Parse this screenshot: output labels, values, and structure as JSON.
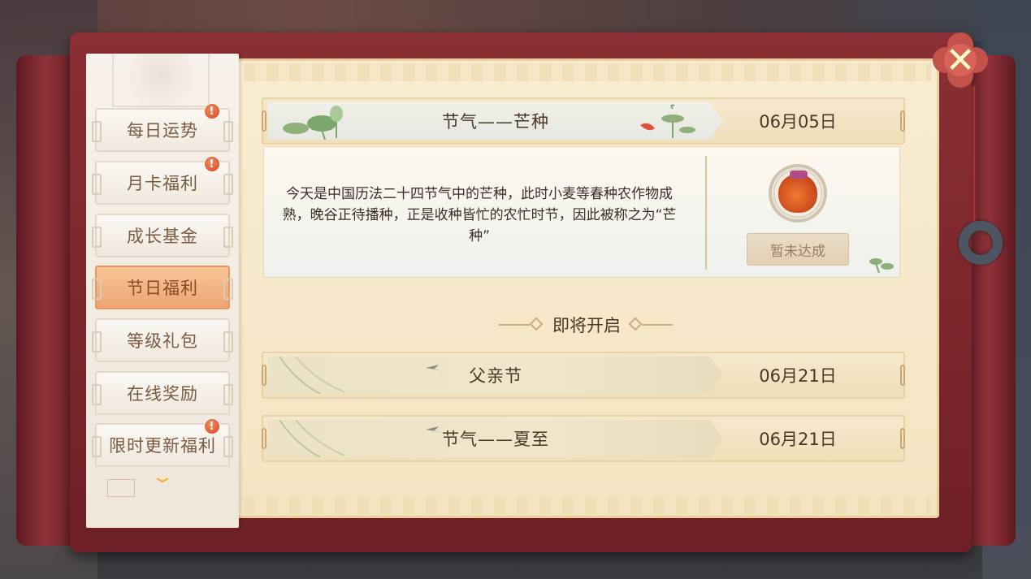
{
  "sidebar": {
    "items": [
      {
        "label": "每日运势",
        "badge": "!"
      },
      {
        "label": "月卡福利",
        "badge": "!"
      },
      {
        "label": "成长基金",
        "badge": ""
      },
      {
        "label": "节日福利",
        "badge": "",
        "active": true
      },
      {
        "label": "等级礼包",
        "badge": ""
      },
      {
        "label": "在线奖励",
        "badge": ""
      },
      {
        "label": "限时更新福利",
        "badge": "!"
      }
    ],
    "more_icon": "chevron-down-icon"
  },
  "current_festival": {
    "name": "节气——芒种",
    "date": "06月05日",
    "description": "今天是中国历法二十四节气中的芒种，此时小麦等春种农作物成熟，晚谷正待播种，正是收种皆忙的农忙时节，因此被称之为“芒种”",
    "reward_icon": "lucky-bag-icon",
    "status_label": "暂未达成"
  },
  "upcoming": {
    "heading": "即将开启",
    "items": [
      {
        "name": "父亲节",
        "date": "06月21日"
      },
      {
        "name": "节气——夏至",
        "date": "06月21日"
      }
    ]
  },
  "close_icon": "close-icon",
  "colors": {
    "scroll_red": "#8a2f33",
    "paper": "#f8ecd0",
    "active_tab": "#f0ae7c",
    "badge": "#d6452a",
    "text_dark": "#4a3526"
  }
}
